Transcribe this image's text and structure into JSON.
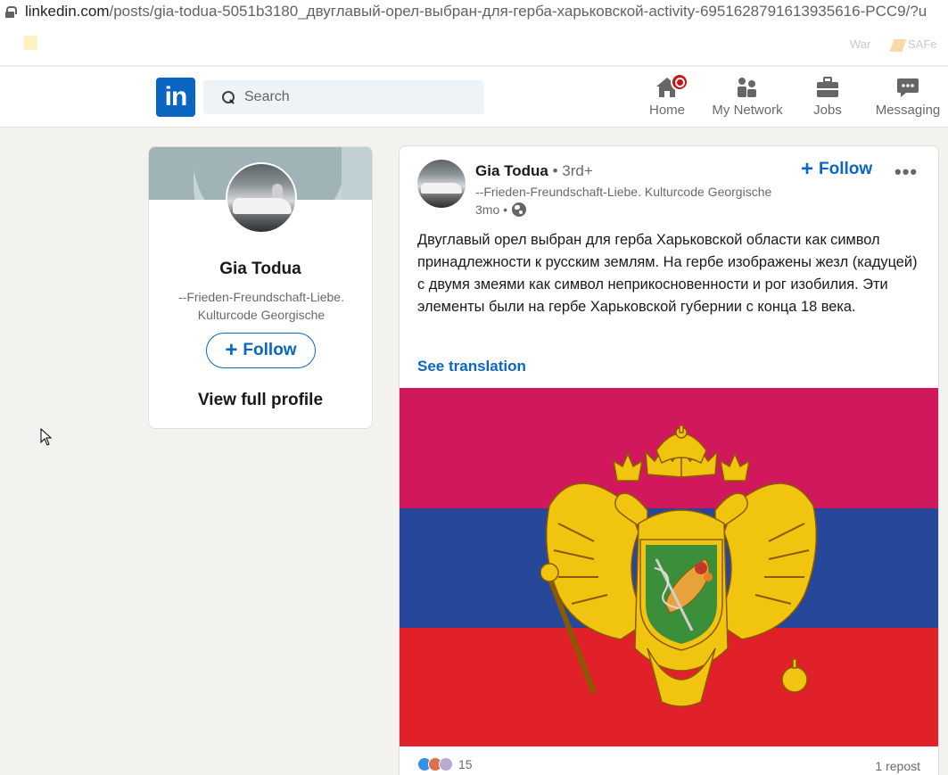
{
  "browser": {
    "url_domain": "linkedin.com",
    "url_path": "/posts/gia-todua-5051b3180_двуглавый-орел-выбран-для-герба-харьковской-activity-6951628791613935616-PCC9/?u"
  },
  "bookmarks": {
    "right_item_1": "War",
    "right_item_2": "SAFe"
  },
  "nav": {
    "logo": "in",
    "search_placeholder": "Search",
    "items": [
      {
        "label": "Home",
        "icon": "home-icon"
      },
      {
        "label": "My Network",
        "icon": "network-icon"
      },
      {
        "label": "Jobs",
        "icon": "briefcase-icon"
      },
      {
        "label": "Messaging",
        "icon": "messaging-icon"
      }
    ]
  },
  "profile": {
    "name": "Gia Todua",
    "headline": "--Frieden-Freundschaft-Liebe. Kulturcode Georgische",
    "follow_label": "Follow",
    "view_profile_label": "View full profile"
  },
  "post": {
    "author_name": "Gia Todua",
    "author_degree": " • 3rd+",
    "author_headline": "--Frieden-Freundschaft-Liebe. Kulturcode Georgische",
    "time": "3mo •",
    "follow_label": "Follow",
    "more": "•••",
    "text": "Двуглавый орел выбран для герба Харьковской области как символ принадлежности к русским землям. На гербе изображены жезл (кадуцей) с двумя змеями как символ неприкосновенности и рог изобилия. Эти элементы были на гербе Харьковской губернии с конца 18 века.",
    "see_translation": "See translation",
    "reaction_count": "15",
    "reposts": "1 repost"
  },
  "colors": {
    "linkedin_blue": "#0a66c2",
    "flag_top": "#d2185c",
    "flag_middle": "#26479a",
    "flag_bottom": "#e0212a",
    "eagle_gold": "#f1c40f",
    "shield_green": "#3c8f3a"
  }
}
